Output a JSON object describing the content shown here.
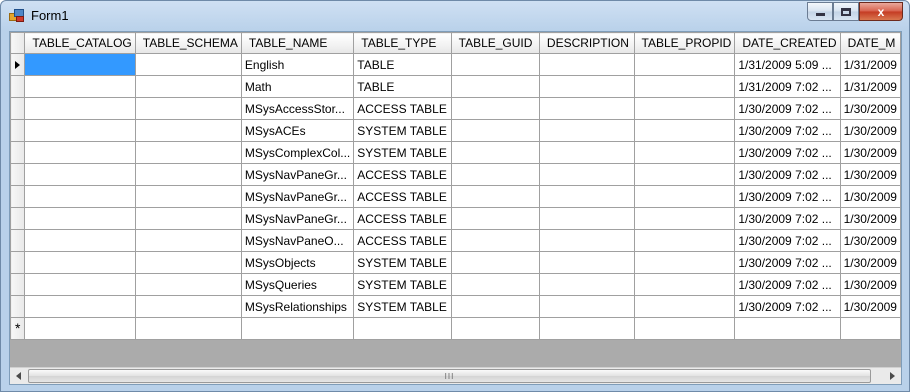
{
  "window": {
    "title": "Form1",
    "buttons": {
      "minimize": "minimize",
      "maximize": "maximize",
      "close": "x"
    }
  },
  "grid": {
    "columns": [
      "TABLE_CATALOG",
      "TABLE_SCHEMA",
      "TABLE_NAME",
      "TABLE_TYPE",
      "TABLE_GUID",
      "DESCRIPTION",
      "TABLE_PROPID",
      "DATE_CREATED",
      "DATE_M"
    ],
    "rows": [
      [
        "",
        "",
        "English",
        "TABLE",
        "",
        "",
        "",
        "1/31/2009 5:09 ...",
        "1/31/2009"
      ],
      [
        "",
        "",
        "Math",
        "TABLE",
        "",
        "",
        "",
        "1/31/2009 7:02 ...",
        "1/31/2009"
      ],
      [
        "",
        "",
        "MSysAccessStor...",
        "ACCESS TABLE",
        "",
        "",
        "",
        "1/30/2009 7:02 ...",
        "1/30/2009"
      ],
      [
        "",
        "",
        "MSysACEs",
        "SYSTEM TABLE",
        "",
        "",
        "",
        "1/30/2009 7:02 ...",
        "1/30/2009"
      ],
      [
        "",
        "",
        "MSysComplexCol...",
        "SYSTEM TABLE",
        "",
        "",
        "",
        "1/30/2009 7:02 ...",
        "1/30/2009"
      ],
      [
        "",
        "",
        "MSysNavPaneGr...",
        "ACCESS TABLE",
        "",
        "",
        "",
        "1/30/2009 7:02 ...",
        "1/30/2009"
      ],
      [
        "",
        "",
        "MSysNavPaneGr...",
        "ACCESS TABLE",
        "",
        "",
        "",
        "1/30/2009 7:02 ...",
        "1/30/2009"
      ],
      [
        "",
        "",
        "MSysNavPaneGr...",
        "ACCESS TABLE",
        "",
        "",
        "",
        "1/30/2009 7:02 ...",
        "1/30/2009"
      ],
      [
        "",
        "",
        "MSysNavPaneO...",
        "ACCESS TABLE",
        "",
        "",
        "",
        "1/30/2009 7:02 ...",
        "1/30/2009"
      ],
      [
        "",
        "",
        "MSysObjects",
        "SYSTEM TABLE",
        "",
        "",
        "",
        "1/30/2009 7:02 ...",
        "1/30/2009"
      ],
      [
        "",
        "",
        "MSysQueries",
        "SYSTEM TABLE",
        "",
        "",
        "",
        "1/30/2009 7:02 ...",
        "1/30/2009"
      ],
      [
        "",
        "",
        "MSysRelationships",
        "SYSTEM TABLE",
        "",
        "",
        "",
        "1/30/2009 7:02 ...",
        "1/30/2009"
      ]
    ],
    "current_row_icon": "row-pointer-icon",
    "new_row_icon": "new-row-asterisk-icon",
    "new_row_glyph": "*",
    "selection_color": "#3399ff"
  },
  "scrollbar": {
    "left_icon": "scroll-left-icon",
    "right_icon": "scroll-right-icon",
    "grip": "III"
  }
}
